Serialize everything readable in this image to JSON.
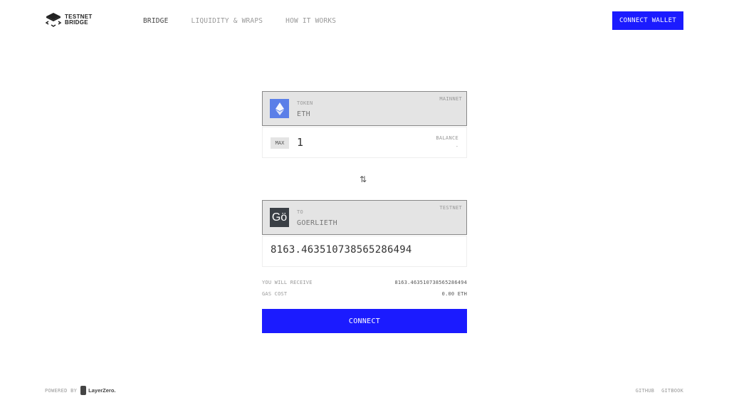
{
  "header": {
    "logo_line1": "TESTNET",
    "logo_line2": "BRIDGE",
    "nav": [
      {
        "label": "BRIDGE",
        "active": true
      },
      {
        "label": "LIQUIDITY & WRAPS",
        "active": false
      },
      {
        "label": "HOW IT WORKS",
        "active": false
      }
    ],
    "connect_wallet_label": "CONNECT WALLET"
  },
  "from": {
    "label": "TOKEN",
    "token": "ETH",
    "network": "MAINNET",
    "icon": "ethereum-icon",
    "max_label": "MAX",
    "amount": "1",
    "balance_label": "BALANCE",
    "balance_value": "-"
  },
  "swap_icon": "⇅",
  "to": {
    "label": "TO",
    "token": "GOERLIETH",
    "network": "TESTNET",
    "icon_text": "Gö",
    "amount": "8163.463510738565286494"
  },
  "summary": {
    "receive_label": "YOU WILL RECEIVE",
    "receive_value": "8163.463510738565286494",
    "gas_label": "GAS COST",
    "gas_value": "0.00 ETH"
  },
  "connect_label": "CONNECT",
  "footer": {
    "powered_by": "POWERED BY",
    "brand": "LayerZero.",
    "links": [
      "GITHUB",
      "GITBOOK"
    ]
  },
  "colors": {
    "accent": "#1b1bff",
    "eth_icon_bg": "#5b7fe8",
    "goerli_icon_bg": "#3a3f45"
  }
}
